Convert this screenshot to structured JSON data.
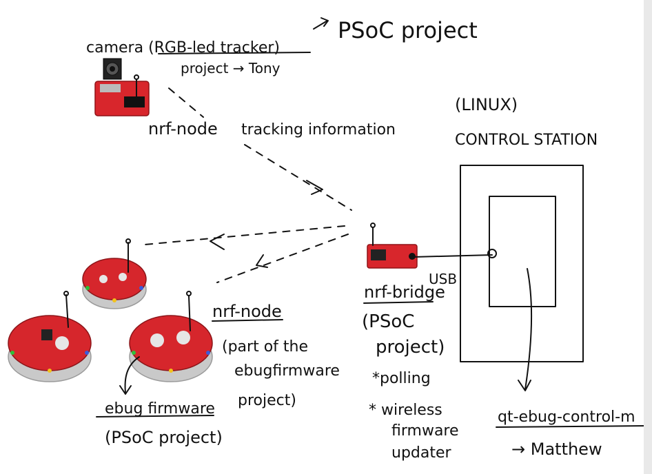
{
  "labels": {
    "camera_line1": "camera (RGB-led tracker)",
    "camera_line2": "project → Tony",
    "psoc_project_top": "PSoC project",
    "nrf_node_top": "nrf-node",
    "tracking": "tracking information",
    "linux": "(LINUX)",
    "control_station": "CONTROL STATION",
    "usb": "USB",
    "nrf_bridge": "nrf-bridge",
    "bridge_paren1": "(PSoC",
    "bridge_paren2": "project)",
    "bridge_bullet1": "*polling",
    "bridge_bullet2a": "* wireless",
    "bridge_bullet2b": "firmware",
    "bridge_bullet2c": "updater",
    "nrf_node_bottom": "nrf-node",
    "part_line1": "(part of the",
    "part_line2": "ebugfirmware",
    "part_line3": "project)",
    "ebug_firmware": "ebug firmware",
    "ebug_psoc": "(PSoC project)",
    "qt_ebug": "qt-ebug-control-m",
    "matthew": "→ Matthew"
  },
  "colors": {
    "ink": "#111111",
    "board_red": "#d8262c",
    "led_green": "#2fbf3a",
    "led_blue": "#3b5bdb",
    "led_yellow": "#f2c21b"
  }
}
